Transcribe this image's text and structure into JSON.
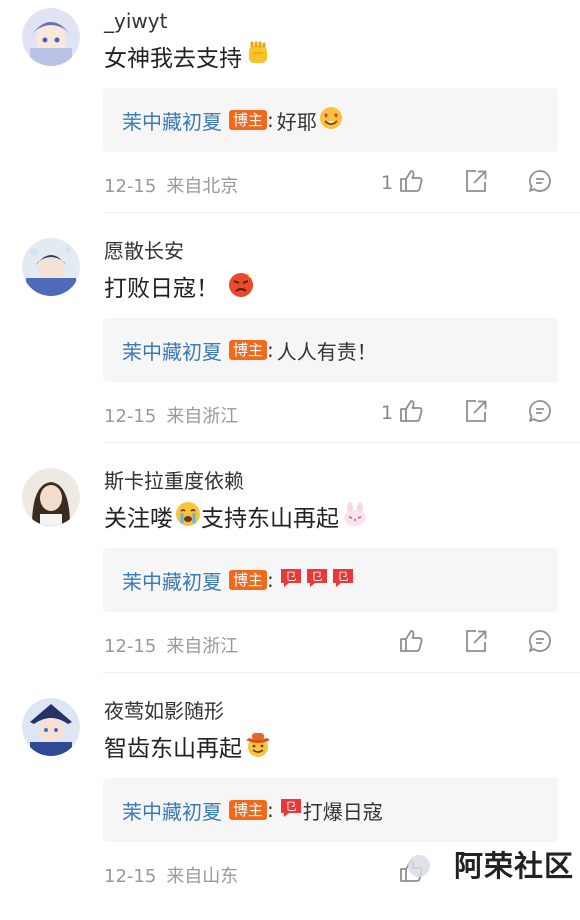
{
  "comments": [
    {
      "username": "_yiwyt",
      "content": "女神我去支持",
      "content_emoji": "fist-emoji",
      "reply_author": "茉中藏初夏",
      "badge": "博主",
      "reply_text": "好耶",
      "reply_emoji": "heart-eyes-emoji",
      "date": "12-15",
      "location": "来自北京",
      "likes": "1"
    },
    {
      "username": "愿散长安",
      "content": "打败日寇！",
      "content_emoji": "angry-face-emoji",
      "reply_author": "茉中藏初夏",
      "badge": "博主",
      "reply_text": "人人有责！",
      "reply_emoji": "",
      "date": "12-15",
      "location": "来自浙江",
      "likes": "1"
    },
    {
      "username": "斯卡拉重度依赖",
      "content": "关注喽",
      "content_middle": "支持东山再起",
      "content_emoji": "crying-face-emoji",
      "content_emoji_end": "bunny-face-emoji",
      "reply_author": "茉中藏初夏",
      "badge": "博主",
      "reply_text": "",
      "reply_emoji": "gou-sticker-x3",
      "date": "12-15",
      "location": "来自浙江",
      "likes": ""
    },
    {
      "username": "夜莺如影随形",
      "content": "智齿东山再起",
      "content_emoji": "cowboy-hat-emoji",
      "reply_author": "茉中藏初夏",
      "badge": "博主",
      "reply_text": "打爆日寇",
      "reply_emoji": "gou-sticker",
      "date": "12-15",
      "location": "来自山东",
      "likes": ""
    }
  ],
  "sticker_text": "㔾",
  "watermark": "阿荣社区",
  "colors": {
    "reply_author": "#3a7ab8",
    "badge": "#f2691b",
    "meta": "#999999",
    "reply_bg": "#f6f6f6"
  }
}
